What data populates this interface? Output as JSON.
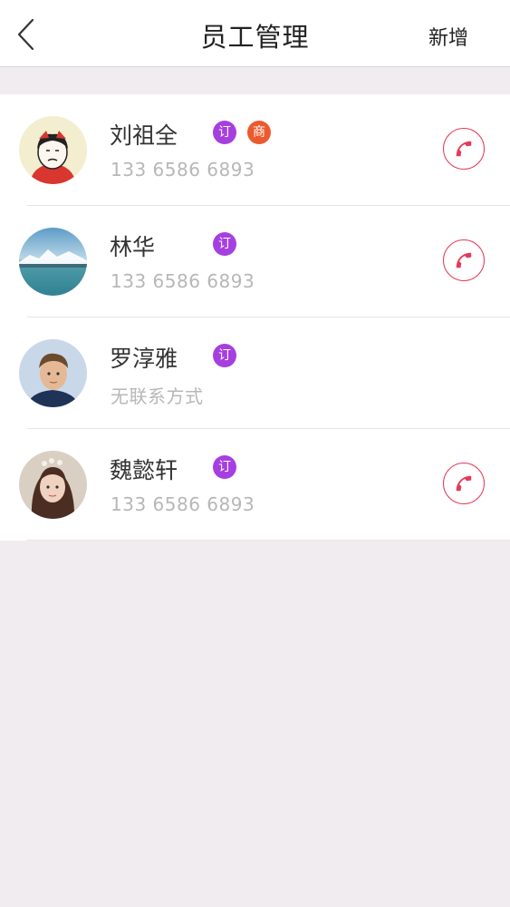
{
  "header": {
    "title": "员工管理",
    "add_label": "新增"
  },
  "employees": [
    {
      "name": "刘祖全",
      "phone": "133 6586 6893",
      "badges": [
        "订",
        "商"
      ],
      "has_phone": true
    },
    {
      "name": "林华",
      "phone": "133 6586 6893",
      "badges": [
        "订"
      ],
      "has_phone": true
    },
    {
      "name": "罗淳雅",
      "phone": "无联系方式",
      "badges": [
        "订"
      ],
      "has_phone": false
    },
    {
      "name": "魏懿轩",
      "phone": "133 6586 6893",
      "badges": [
        "订"
      ],
      "has_phone": true
    }
  ],
  "colors": {
    "badge_order": "#a63fe0",
    "badge_merchant": "#ec5a2e",
    "call_accent": "#e43a5a"
  },
  "icons": {
    "back": "chevron-left-icon",
    "call": "phone-icon"
  }
}
